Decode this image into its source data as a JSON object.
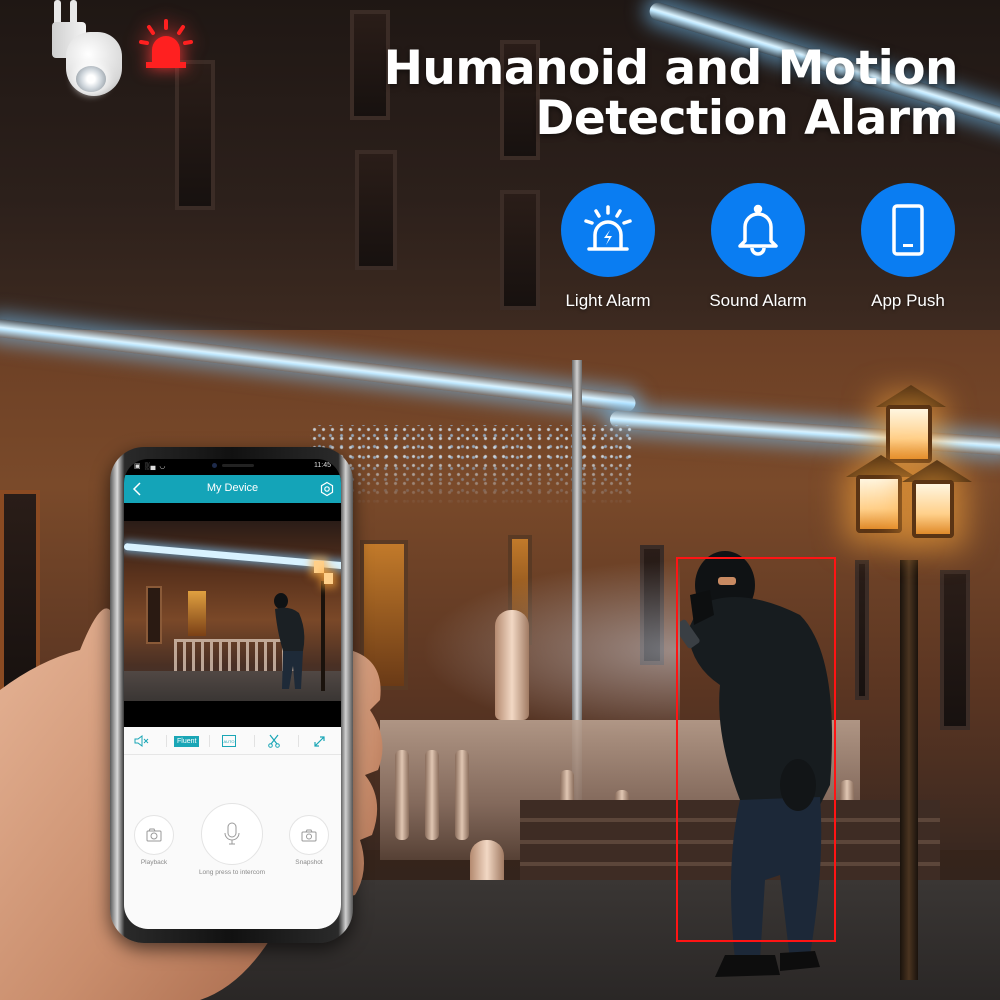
{
  "headline": {
    "line1": "Humanoid and Motion",
    "line2": "Detection Alarm"
  },
  "features": [
    {
      "icon": "siren-light-icon",
      "label": "Light Alarm"
    },
    {
      "icon": "bell-icon",
      "label": "Sound Alarm"
    },
    {
      "icon": "smartphone-icon",
      "label": "App Push"
    }
  ],
  "colors": {
    "feature_blue": "#0a7df2",
    "app_teal": "#14a4b8",
    "detection_red": "#ff1414",
    "siren_red": "#ff2020"
  },
  "phone": {
    "status_bar": {
      "left": "▣ ░▄ ◡",
      "battery": "▭",
      "time": "11:45"
    },
    "app_bar": {
      "title": "My Device",
      "back_icon": "chevron-left-icon",
      "settings_icon": "settings-icon"
    },
    "toolbar": {
      "mute_icon": "speaker-mute-icon",
      "quality_label": "Fluent",
      "auto_label": "AUTO",
      "clip_icon": "scissors-icon",
      "fullscreen_icon": "expand-icon"
    },
    "actions": {
      "playback_label": "Playback",
      "intercom_label": "Long press to intercom",
      "snapshot_label": "Snapshot"
    }
  }
}
